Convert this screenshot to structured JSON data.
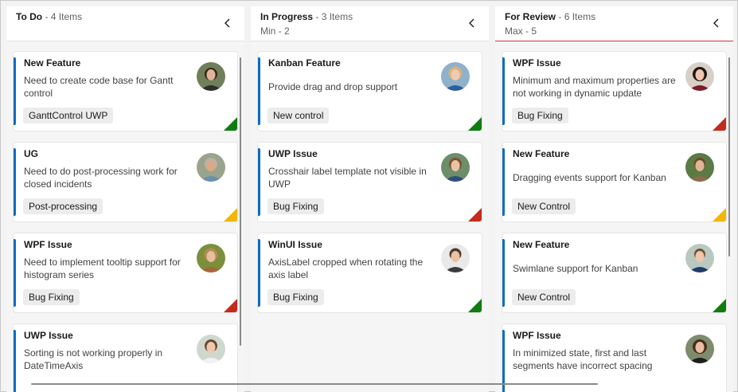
{
  "colors": {
    "accent": "#0f6cbd",
    "low": "#107c10",
    "normal": "#f2b705",
    "high": "#c42b1c",
    "limit": "#d13438"
  },
  "columns": [
    {
      "title": "To Do",
      "separator": "-",
      "count": "4 Items",
      "subtitle": "",
      "cards": [
        {
          "title": "New Feature",
          "description": "Need to create code base for Gantt control",
          "tag": "GanttControl UWP",
          "priority": "low",
          "avatar": "avatar-woman-dark-hair"
        },
        {
          "title": "UG",
          "description": "Need to do post-processing work for closed incidents",
          "tag": "Post-processing",
          "priority": "normal",
          "avatar": "avatar-woman-gray-hair"
        },
        {
          "title": "WPF Issue",
          "description": "Need to implement tooltip support for histogram series",
          "tag": "Bug Fixing",
          "priority": "high",
          "avatar": "avatar-woman-blonde-outdoor"
        },
        {
          "title": "UWP Issue",
          "description": "Sorting is not working properly in DateTimeAxis",
          "tag": "",
          "priority": "",
          "avatar": "avatar-woman-brown-hair"
        }
      ]
    },
    {
      "title": "In Progress",
      "separator": "-",
      "count": "3 Items",
      "subtitle": "Min - 2",
      "cards": [
        {
          "title": "Kanban Feature",
          "description": "Provide drag and drop support",
          "tag": "New control",
          "priority": "low",
          "avatar": "avatar-woman-blonde"
        },
        {
          "title": "UWP Issue",
          "description": "Crosshair label template not visible in UWP",
          "tag": "Bug Fixing",
          "priority": "high",
          "avatar": "avatar-woman-smiling"
        },
        {
          "title": "WinUI Issue",
          "description": "AxisLabel cropped when rotating the axis label",
          "tag": "Bug Fixing",
          "priority": "low",
          "avatar": "avatar-man-dark-hair"
        }
      ]
    },
    {
      "title": "For Review",
      "separator": "-",
      "count": "6 Items",
      "subtitle": "Max - 5",
      "cards": [
        {
          "title": "WPF Issue",
          "description": "Minimum and maximum properties are not working in dynamic update",
          "tag": "Bug Fixing",
          "priority": "high",
          "avatar": "avatar-woman-black-hair"
        },
        {
          "title": "New Feature",
          "description": "Dragging events support for Kanban",
          "tag": "New Control",
          "priority": "normal",
          "avatar": "avatar-man-outdoor"
        },
        {
          "title": "New Feature",
          "description": "Swimlane support for Kanban",
          "tag": "New Control",
          "priority": "low",
          "avatar": "avatar-man-suit"
        },
        {
          "title": "WPF Issue",
          "description": "In minimized state, first and last segments have incorrect spacing",
          "tag": "",
          "priority": "",
          "avatar": "avatar-woman-long-hair"
        }
      ]
    }
  ]
}
